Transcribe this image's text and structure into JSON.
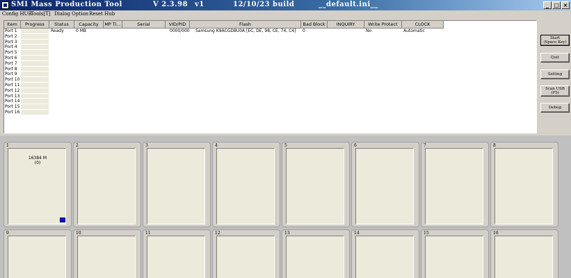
{
  "window": {
    "title": "SMI Mass Production Tool",
    "version": "V 2.3.98",
    "variant": "v1",
    "build": "12/10/23 build",
    "ini": "__default.ini__",
    "controls": {
      "minimize": "_",
      "maximize": "□",
      "close": "×"
    }
  },
  "menu": [
    "Config HUB",
    "Tools[T]",
    "Dialog Option",
    "Reset Hub"
  ],
  "table": {
    "columns": [
      "Item",
      "Progress",
      "Status",
      "Capacity",
      "MP Ti...",
      "Serial",
      "VID/PID",
      "Flash",
      "Bad Block",
      "INQUIRY",
      "Write Protect",
      "CLOCK"
    ],
    "rows": [
      {
        "item": "Port 1",
        "status": "Ready",
        "capacity": "0 MB",
        "vidpid": "0000/0000",
        "flash": "Samsung K9ACGD8U0A [EC, DE, 98, CE, 74, C4]",
        "badblock": "0",
        "writeprotect": "No",
        "clock": "Automatic"
      },
      {
        "item": "Port 2"
      },
      {
        "item": "Port 3"
      },
      {
        "item": "Port 4"
      },
      {
        "item": "Port 5"
      },
      {
        "item": "Port 6"
      },
      {
        "item": "Port 7"
      },
      {
        "item": "Port 8"
      },
      {
        "item": "Port 9"
      },
      {
        "item": "Port 10"
      },
      {
        "item": "Port 11"
      },
      {
        "item": "Port 12"
      },
      {
        "item": "Port 13"
      },
      {
        "item": "Port 14"
      },
      {
        "item": "Port 15"
      },
      {
        "item": "Port 16"
      }
    ]
  },
  "buttons": {
    "start_line1": "Start",
    "start_line2": "(Space Key)",
    "quit": "Quit",
    "setting": "Setting",
    "scan_line1": "Scan USB",
    "scan_line2": "(F5)",
    "debug": "Debug"
  },
  "ports": [
    {
      "num": "1",
      "capacity": "16384 M",
      "count": "(0)",
      "led_color": "#0018c8"
    },
    {
      "num": "2"
    },
    {
      "num": "3"
    },
    {
      "num": "4"
    },
    {
      "num": "5"
    },
    {
      "num": "6"
    },
    {
      "num": "7"
    },
    {
      "num": "8"
    },
    {
      "num": "9"
    },
    {
      "num": "10"
    },
    {
      "num": "11"
    },
    {
      "num": "12"
    },
    {
      "num": "13"
    },
    {
      "num": "14"
    },
    {
      "num": "15"
    },
    {
      "num": "16"
    }
  ]
}
